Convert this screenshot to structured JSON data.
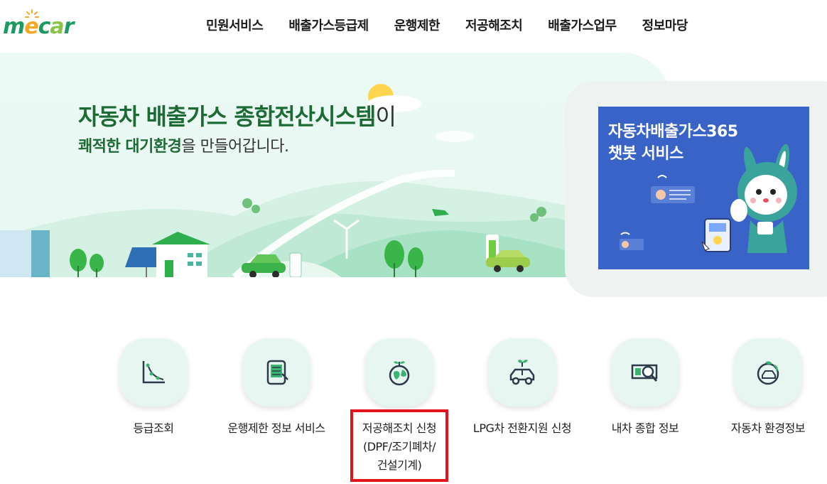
{
  "logo": {
    "text": "mecar",
    "brand_colors": [
      "#1d9a62",
      "#f5a623"
    ]
  },
  "nav": {
    "items": [
      "민원서비스",
      "배출가스등급제",
      "운행제한",
      "저공해조치",
      "배출가스업무",
      "정보마당"
    ]
  },
  "hero": {
    "title_part1": "자동차 배출가스 종합전산시스템",
    "title_part2": "이",
    "sub_part1": "쾌적한 대기환경",
    "sub_part2": "을 만들어갑니다."
  },
  "banner": {
    "line1": "자동차배출가스365",
    "line2": "챗봇 서비스"
  },
  "services": [
    {
      "label": "등급조회",
      "icon": "graph-icon"
    },
    {
      "label": "운행제한 정보 서비스",
      "icon": "tablet-icon"
    },
    {
      "label_lines": [
        "저공해조치 신청",
        "(DPF/조기폐차/",
        "건설기계)"
      ],
      "icon": "globe-sprout-icon",
      "highlighted": true
    },
    {
      "label": "LPG차 전환지원 신청",
      "icon": "eco-car-icon"
    },
    {
      "label": "내차 종합 정보",
      "icon": "car-search-icon"
    },
    {
      "label": "자동차 환경정보",
      "icon": "eco-recycle-icon"
    }
  ],
  "colors": {
    "accent_green": "#1c6b35",
    "highlight_red": "#e2141e",
    "banner_blue": "#3a63c8"
  }
}
